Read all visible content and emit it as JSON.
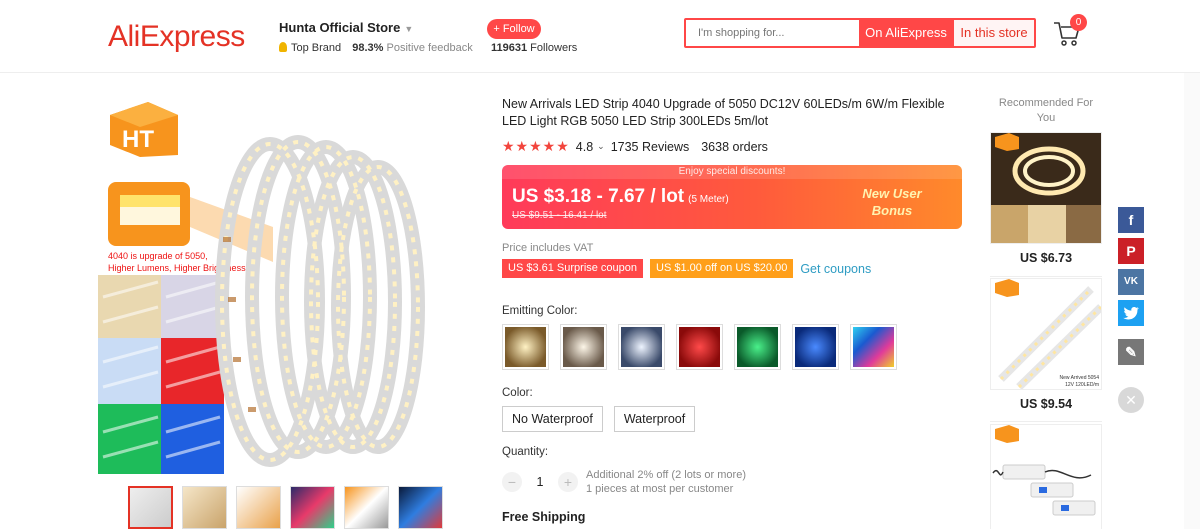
{
  "header": {
    "logo": "AliExpress",
    "store_name": "Hunta Official Store",
    "top_brand": "Top Brand",
    "positive_pct": "98.3%",
    "positive_label": "Positive feedback",
    "follow_label": "+ Follow",
    "followers_count": "119631",
    "followers_label": "Followers",
    "search_placeholder": "I'm shopping for...",
    "btn_aliexpress": "On AliExpress",
    "btn_store": "In this store",
    "cart_count": "0"
  },
  "gallery": {
    "brand_badge": "HT",
    "callout_line1": "4040 is upgrade of 5050,",
    "callout_line2": "Higher Lumens, Higher Brightness",
    "thumb_count": 6
  },
  "product": {
    "title": "New Arrivals LED Strip 4040 Upgrade of 5050 DC12V 60LEDs/m 6W/m Flexible LED Light RGB 5050 LED Strip 300LEDs 5m/lot",
    "stars": "★★★★★",
    "rating": "4.8",
    "reviews": "1735 Reviews",
    "orders": "3638 orders",
    "discount_banner": "Enjoy special discounts!",
    "price": "US $3.18 - 7.67 / lot",
    "price_unit": "(5 Meter)",
    "price_original": "US $9.51 - 16.41 / lot",
    "new_user_line1": "New User",
    "new_user_line2": "Bonus",
    "vat": "Price includes VAT",
    "coupon1": "US $3.61 Surprise coupon",
    "coupon2": "US $1.00 off on US $20.00",
    "get_coupons": "Get coupons",
    "emitting_color_label": "Emitting Color:",
    "color_label": "Color:",
    "color_options": [
      "No Waterproof",
      "Waterproof"
    ],
    "quantity_label": "Quantity:",
    "quantity_value": "1",
    "qty_note1": "Additional 2% off (2 lots or more)",
    "qty_note2": "1 pieces at most per customer",
    "shipping": "Free Shipping"
  },
  "recommended": {
    "title": "Recommended For You",
    "items": [
      {
        "price": "US $6.73"
      },
      {
        "price": "US $9.54",
        "caption1": "New Arrived 5054",
        "caption2": "12V 120LED/m"
      },
      {
        "price": ""
      }
    ]
  },
  "colors": {
    "accent": "#ff4747",
    "brand": "#e43225"
  }
}
